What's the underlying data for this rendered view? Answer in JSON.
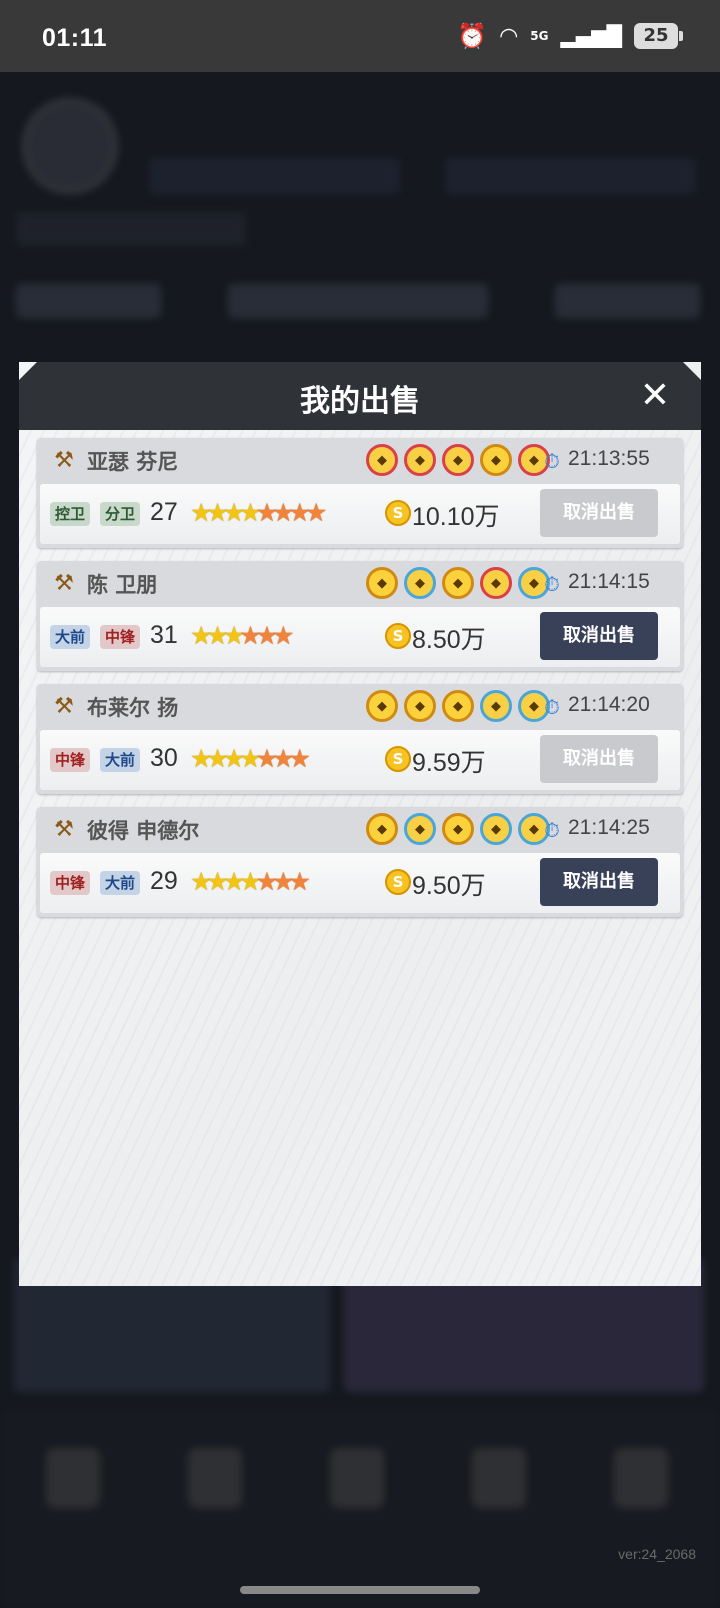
{
  "status_bar": {
    "time": "01:11",
    "network": "5G",
    "battery": "25"
  },
  "version": "ver:24_2068",
  "modal": {
    "title": "我的出售",
    "close_label": "✕",
    "listings": [
      {
        "name": "亚瑟 芬尼",
        "positions": [
          {
            "label": "控卫",
            "color": "green"
          },
          {
            "label": "分卫",
            "color": "green"
          }
        ],
        "level": "27",
        "stars": {
          "yellow": 4,
          "orange": 4
        },
        "badges": [
          "red",
          "red",
          "red",
          "gold",
          "red"
        ],
        "time": "21:13:55",
        "price": "10.10万",
        "cancel_label": "取消出售",
        "cancel_enabled": false
      },
      {
        "name": "陈 卫朋",
        "positions": [
          {
            "label": "大前",
            "color": "blue"
          },
          {
            "label": "中锋",
            "color": "red"
          }
        ],
        "level": "31",
        "stars": {
          "yellow": 3,
          "orange": 3
        },
        "badges": [
          "gold",
          "blue",
          "gold",
          "red",
          "blue"
        ],
        "time": "21:14:15",
        "price": "8.50万",
        "cancel_label": "取消出售",
        "cancel_enabled": true
      },
      {
        "name": "布莱尔 扬",
        "positions": [
          {
            "label": "中锋",
            "color": "red"
          },
          {
            "label": "大前",
            "color": "blue"
          }
        ],
        "level": "30",
        "stars": {
          "yellow": 4,
          "orange": 3
        },
        "badges": [
          "gold",
          "gold",
          "gold",
          "blue",
          "blue"
        ],
        "time": "21:14:20",
        "price": "9.59万",
        "cancel_label": "取消出售",
        "cancel_enabled": false
      },
      {
        "name": "彼得 申德尔",
        "positions": [
          {
            "label": "中锋",
            "color": "red"
          },
          {
            "label": "大前",
            "color": "blue"
          }
        ],
        "level": "29",
        "stars": {
          "yellow": 4,
          "orange": 3
        },
        "badges": [
          "gold",
          "blue",
          "gold",
          "blue",
          "blue"
        ],
        "time": "21:14:25",
        "price": "9.50万",
        "cancel_label": "取消出售",
        "cancel_enabled": true
      }
    ]
  },
  "icons": {
    "hammer": "auction-hammer-icon",
    "timer": "stopwatch-icon",
    "coin": "gold-coin-icon",
    "close": "close-icon"
  }
}
